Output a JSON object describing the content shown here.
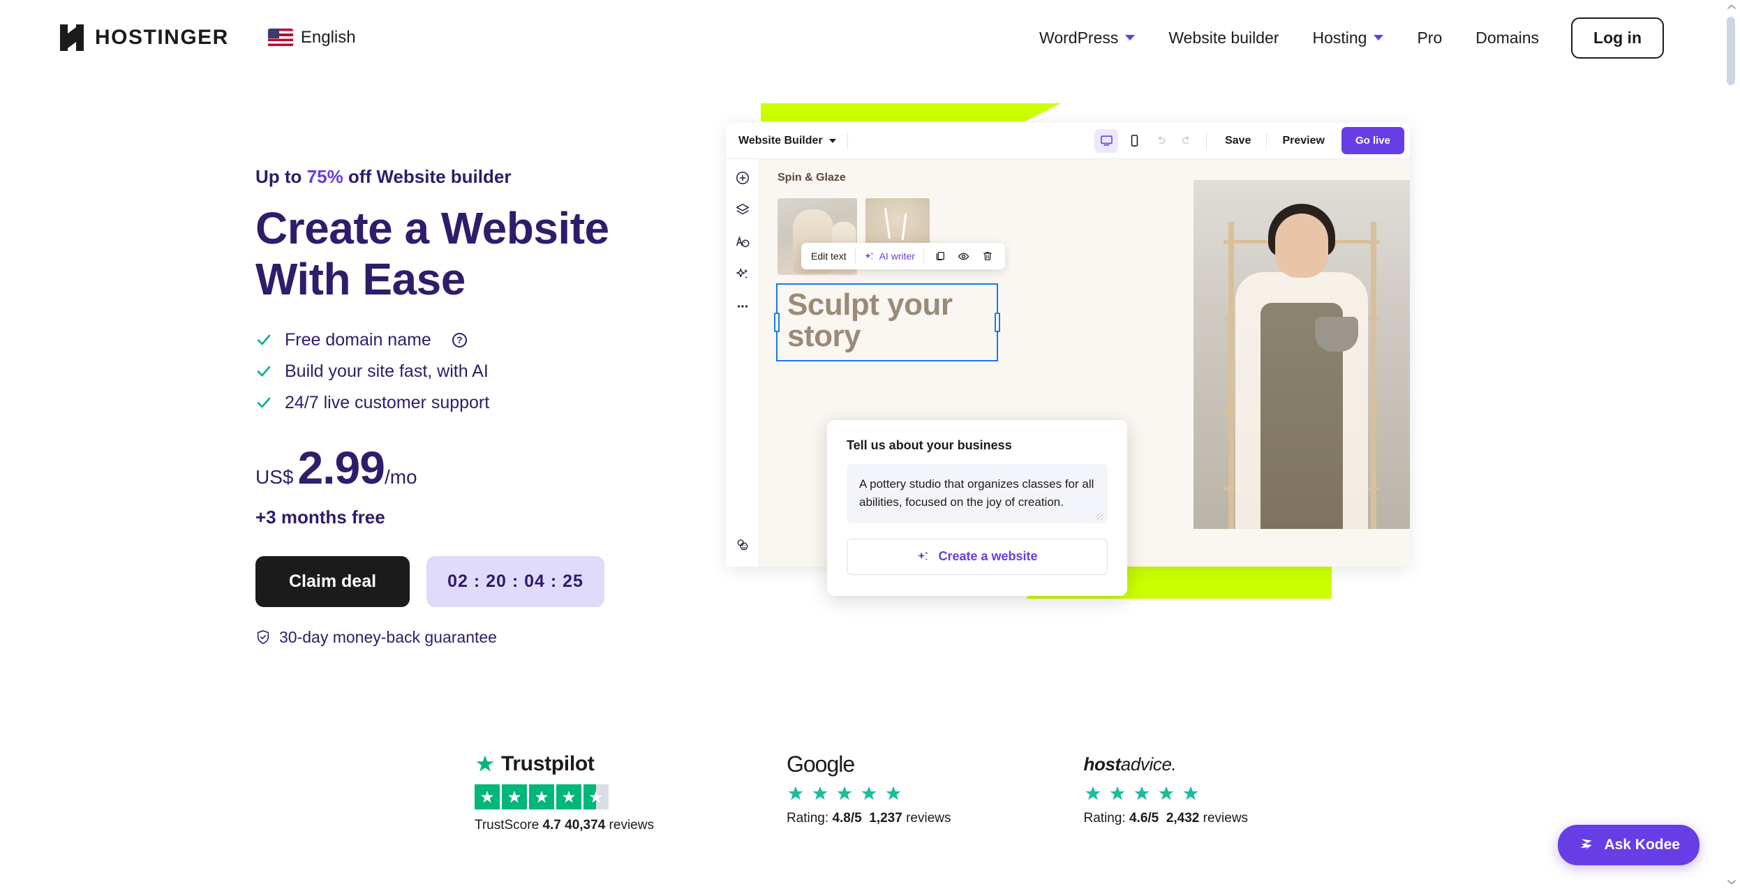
{
  "header": {
    "brand_name": "HOSTINGER",
    "logo_icon": "hostinger-h-logo",
    "language": "English",
    "flag_icon": "us-flag-icon",
    "nav": [
      {
        "label": "WordPress",
        "has_dropdown": true
      },
      {
        "label": "Website builder",
        "has_dropdown": false
      },
      {
        "label": "Hosting",
        "has_dropdown": true
      },
      {
        "label": "Pro",
        "has_dropdown": false
      },
      {
        "label": "Domains",
        "has_dropdown": false
      }
    ],
    "login_label": "Log in"
  },
  "hero": {
    "eyebrow_prefix": "Up to ",
    "eyebrow_pct": "75%",
    "eyebrow_suffix": " off Website builder",
    "title": "Create a Website With Ease",
    "features": [
      {
        "label": "Free domain name",
        "has_info": true
      },
      {
        "label": "Build your site fast, with AI",
        "has_info": false
      },
      {
        "label": "24/7 live customer support",
        "has_info": false
      }
    ],
    "currency": "US$",
    "amount": "2.99",
    "period": "/mo",
    "months_free": "+3 months free",
    "claim_label": "Claim deal",
    "timer": "02 : 20 : 04 : 25",
    "guarantee": "30-day money-back guarantee",
    "guarantee_icon": "shield-check-icon"
  },
  "builder": {
    "title": "Website Builder",
    "desktop_icon": "desktop-monitor-icon",
    "mobile_icon": "mobile-phone-icon",
    "undo_icon": "undo-arrow-icon",
    "redo_icon": "redo-arrow-icon",
    "save_label": "Save",
    "preview_label": "Preview",
    "golive_label": "Go live",
    "rail_icons": [
      "add-plus-circle-icon",
      "layers-icon",
      "typography-palette-icon",
      "ai-sparkle-icon",
      "more-ellipsis-icon"
    ],
    "rail_bottom_icon": "feedback-faces-icon",
    "canvas": {
      "site_brand": "Spin & Glaze",
      "headline": "Sculpt your story",
      "image_alt": "potter-holding-bowl-photo",
      "thumb_a_alt": "clay-vases-thumbnail",
      "thumb_b_alt": "dried-flowers-thumbnail"
    },
    "edit_toolbar": {
      "edit_label": "Edit text",
      "ai_label": "AI writer",
      "ai_icon": "ai-sparkle-icon",
      "duplicate_icon": "duplicate-copy-icon",
      "visibility_icon": "eye-visibility-icon",
      "delete_icon": "trash-delete-icon"
    },
    "ai_panel": {
      "title": "Tell us about your business",
      "textarea_value": "A pottery studio that organizes classes for all abilities, focused on the joy of creation.",
      "button_label": "Create a website",
      "button_icon": "ai-sparkle-icon"
    }
  },
  "reviews": [
    {
      "brand": "Trustpilot",
      "logo_icon": "trustpilot-star-logo",
      "stars_full": 4,
      "stars_half": true,
      "score_prefix": "TrustScore ",
      "score": "4.7",
      "count": "40,374",
      "count_suffix": " reviews"
    },
    {
      "brand": "Google",
      "logo_icon": "google-wordmark",
      "stars_full": 5,
      "stars_half": false,
      "score_prefix": "Rating: ",
      "score": "4.8/5",
      "count": "1,237",
      "count_suffix": " reviews"
    },
    {
      "brand": "hostadvice.",
      "brand_bold": "host",
      "brand_rest": "advice.",
      "logo_icon": "hostadvice-wordmark",
      "stars_full": 5,
      "stars_half": false,
      "score_prefix": "Rating: ",
      "score": "4.6/5",
      "count": "2,432",
      "count_suffix": " reviews"
    }
  ],
  "kodee": {
    "label": "Ask Kodee",
    "icon": "kodee-bird-icon"
  },
  "colors": {
    "brand_purple": "#673de6",
    "deep_purple": "#2f1c6a",
    "lime": "#ccff00",
    "green_check": "#00b090",
    "trustpilot_green": "#00b67a",
    "star_teal": "#1bbc9b",
    "dark": "#1b1b1b",
    "canvas_bg": "#faf6f1",
    "taupe_text": "#9a8b78",
    "selection_blue": "#1877f2",
    "timer_bg": "#e0dbfa"
  }
}
